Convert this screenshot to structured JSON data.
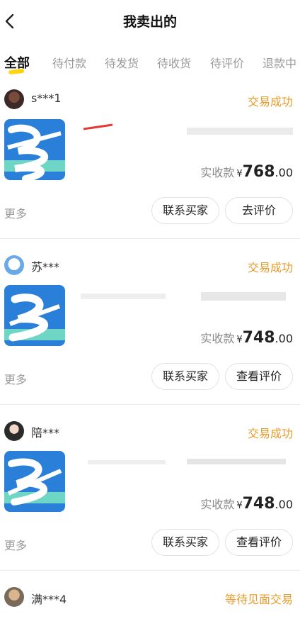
{
  "header": {
    "title": "我卖出的",
    "back_icon": "chevron-left-icon"
  },
  "tabs": [
    {
      "label": "全部",
      "active": true
    },
    {
      "label": "待付款"
    },
    {
      "label": "待发货"
    },
    {
      "label": "待收货"
    },
    {
      "label": "待评价"
    },
    {
      "label": "退款中"
    }
  ],
  "orders": [
    {
      "buyer": "s***1",
      "status": "交易成功",
      "price_label": "实收款",
      "currency": "¥",
      "price_int": "768",
      "price_dec": ".00",
      "more": "更多",
      "actions": [
        "联系买家",
        "去评价"
      ]
    },
    {
      "buyer": "苏***",
      "status": "交易成功",
      "price_label": "实收款",
      "currency": "¥",
      "price_int": "748",
      "price_dec": ".00",
      "more": "更多",
      "actions": [
        "联系买家",
        "查看评价"
      ]
    },
    {
      "buyer": "陪***",
      "status": "交易成功",
      "price_label": "实收款",
      "currency": "¥",
      "price_int": "748",
      "price_dec": ".00",
      "more": "更多",
      "actions": [
        "联系买家",
        "查看评价"
      ]
    },
    {
      "buyer": "满***4",
      "status": "等待见面交易"
    }
  ],
  "colors": {
    "status": "#e89b2a",
    "tab_indicator": "#ffd200",
    "muted": "#9a9a9a"
  }
}
